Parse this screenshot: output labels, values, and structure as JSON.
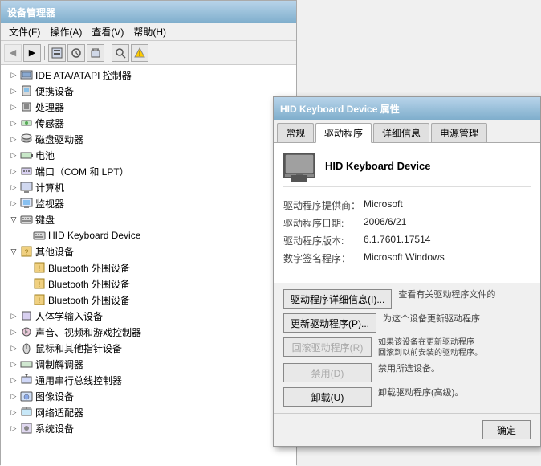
{
  "mainWindow": {
    "title": "设备管理器",
    "menus": [
      "文件(F)",
      "操作(A)",
      "查看(V)",
      "帮助(H)"
    ],
    "toolbar": {
      "buttons": [
        "back",
        "forward",
        "up",
        "properties",
        "update",
        "uninstall",
        "scan",
        "warning"
      ]
    },
    "tree": [
      {
        "id": "ide",
        "label": "IDE ATA/ATAPI 控制器",
        "level": 1,
        "expanded": false,
        "hasToggle": true
      },
      {
        "id": "portable",
        "label": "便携设备",
        "level": 1,
        "expanded": false,
        "hasToggle": true
      },
      {
        "id": "processor",
        "label": "处理器",
        "level": 1,
        "expanded": false,
        "hasToggle": true
      },
      {
        "id": "sensor",
        "label": "传感器",
        "level": 1,
        "expanded": false,
        "hasToggle": true
      },
      {
        "id": "disk",
        "label": "磁盘驱动器",
        "level": 1,
        "expanded": false,
        "hasToggle": true
      },
      {
        "id": "battery",
        "label": "电池",
        "level": 1,
        "expanded": false,
        "hasToggle": true
      },
      {
        "id": "port",
        "label": "端口（COM 和 LPT）",
        "level": 1,
        "expanded": false,
        "hasToggle": true
      },
      {
        "id": "computer",
        "label": "计算机",
        "level": 1,
        "expanded": false,
        "hasToggle": true
      },
      {
        "id": "monitor",
        "label": "监视器",
        "level": 1,
        "expanded": false,
        "hasToggle": true
      },
      {
        "id": "keyboard",
        "label": "键盘",
        "level": 1,
        "expanded": true,
        "hasToggle": true
      },
      {
        "id": "hid-keyboard",
        "label": "HID Keyboard Device",
        "level": 2,
        "expanded": false,
        "hasToggle": false,
        "selected": false
      },
      {
        "id": "other",
        "label": "其他设备",
        "level": 1,
        "expanded": true,
        "hasToggle": true
      },
      {
        "id": "bt1",
        "label": "Bluetooth 外围设备",
        "level": 2,
        "expanded": false,
        "hasToggle": false
      },
      {
        "id": "bt2",
        "label": "Bluetooth 外围设备",
        "level": 2,
        "expanded": false,
        "hasToggle": false
      },
      {
        "id": "bt3",
        "label": "Bluetooth 外围设备",
        "level": 2,
        "expanded": false,
        "hasToggle": false
      },
      {
        "id": "hid",
        "label": "人体学输入设备",
        "level": 1,
        "expanded": false,
        "hasToggle": true
      },
      {
        "id": "audio",
        "label": "声音、视频和游戏控制器",
        "level": 1,
        "expanded": false,
        "hasToggle": true
      },
      {
        "id": "mouse",
        "label": "鼠标和其他指针设备",
        "level": 1,
        "expanded": false,
        "hasToggle": true
      },
      {
        "id": "modem",
        "label": "调制解调器",
        "level": 1,
        "expanded": false,
        "hasToggle": true
      },
      {
        "id": "usb",
        "label": "通用串行总线控制器",
        "level": 1,
        "expanded": false,
        "hasToggle": true
      },
      {
        "id": "imaging",
        "label": "图像设备",
        "level": 1,
        "expanded": false,
        "hasToggle": true
      },
      {
        "id": "network",
        "label": "网络适配器",
        "level": 1,
        "expanded": false,
        "hasToggle": true
      },
      {
        "id": "system",
        "label": "系统设备",
        "level": 1,
        "expanded": false,
        "hasToggle": true
      }
    ]
  },
  "dialog": {
    "title": "HID Keyboard Device 属性",
    "tabs": [
      "常规",
      "驱动程序",
      "详细信息",
      "电源管理"
    ],
    "activeTab": "驱动程序",
    "deviceName": "HID Keyboard Device",
    "driverInfo": {
      "providerLabel": "驱动程序提供商：",
      "providerValue": "Microsoft",
      "dateLabel": "驱动程序日期:",
      "dateValue": "2006/6/21",
      "versionLabel": "驱动程序版本:",
      "versionValue": "6.1.7601.17514",
      "signatureLabel": "数字签名程序：",
      "signatureValue": "Microsoft Windows"
    },
    "buttons": [
      {
        "id": "driver-details",
        "label": "驱动程序详细信息(I)...",
        "desc": "查看有关驱动程序文件的",
        "enabled": true
      },
      {
        "id": "update-driver",
        "label": "更新驱动程序(P)...",
        "desc": "为这个设备更新驱动程序",
        "enabled": true
      },
      {
        "id": "rollback-driver",
        "label": "回滚驱动程序(R)",
        "desc": "如果该设备在更新驱动程序后运行失败,\n回滚到以前安装的驱动程序。",
        "enabled": false
      },
      {
        "id": "disable",
        "label": "禁用(D)",
        "desc": "禁用所选设备。",
        "enabled": false
      },
      {
        "id": "uninstall",
        "label": "卸载(U)",
        "desc": "卸载驱动程序(高级)。",
        "enabled": true
      }
    ],
    "footer": {
      "okLabel": "确定"
    }
  }
}
